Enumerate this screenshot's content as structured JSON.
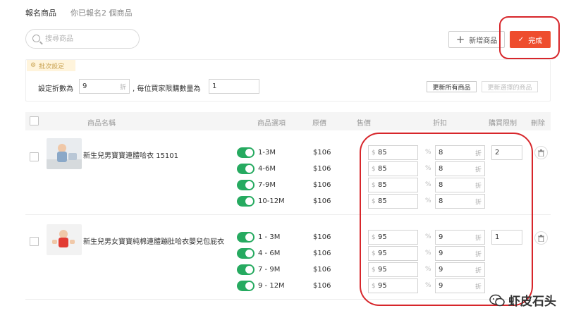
{
  "tabs": {
    "active": "報名商品",
    "count_text": "你已報名2 個商品"
  },
  "search": {
    "placeholder": "搜尋商品"
  },
  "toolbar": {
    "add_label": "新增商品",
    "done_label": "完成"
  },
  "batch": {
    "tag": "批次設定",
    "discount_label": "設定折數為",
    "discount_value": "9",
    "discount_suffix": "折",
    "limit_label": ", 每位買家限購數量為",
    "limit_value": "1",
    "update_all": "更新所有商品",
    "update_selected": "更新選擇的商品"
  },
  "table": {
    "headers": {
      "name": "商品名稱",
      "option": "商品選項",
      "original": "原價",
      "sale": "售價",
      "discount": "折扣",
      "limit": "購買限制",
      "delete": "刪除"
    },
    "currency": "$",
    "discount_unit": "折"
  },
  "products": [
    {
      "name": "新生兒男寶寶連體哈衣 15101",
      "limit": "2",
      "variants": [
        {
          "option": "1-3M",
          "original": "$106",
          "sale": "85",
          "discount": "8"
        },
        {
          "option": "4-6M",
          "original": "$106",
          "sale": "85",
          "discount": "8"
        },
        {
          "option": "7-9M",
          "original": "$106",
          "sale": "85",
          "discount": "8"
        },
        {
          "option": "10-12M",
          "original": "$106",
          "sale": "85",
          "discount": "8"
        }
      ]
    },
    {
      "name": "新生兒男女寶寶純棉連體蹦肚哈衣嬰兒包屁衣",
      "limit": "1",
      "variants": [
        {
          "option": "1 - 3M",
          "original": "$106",
          "sale": "95",
          "discount": "9"
        },
        {
          "option": "4 - 6M",
          "original": "$106",
          "sale": "95",
          "discount": "9"
        },
        {
          "option": "7 - 9M",
          "original": "$106",
          "sale": "95",
          "discount": "9"
        },
        {
          "option": "9 - 12M",
          "original": "$106",
          "sale": "95",
          "discount": "9"
        }
      ]
    }
  ],
  "watermark": {
    "text": "虾皮石头"
  },
  "colors": {
    "accent": "#ee4d2d",
    "toggle_on": "#26aa60",
    "annotation": "#d7262b",
    "batch_tag_bg": "#fff4dc"
  }
}
